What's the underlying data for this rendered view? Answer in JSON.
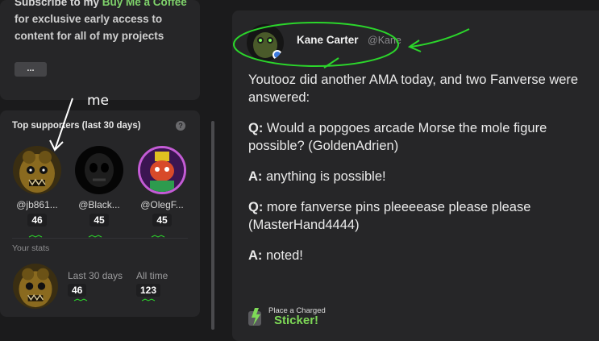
{
  "promo": {
    "line1": "Subscribe to my ",
    "link": "Buy Me a Coffee",
    "line2": " for exclusive early access to content for all of my projects",
    "more_label": "..."
  },
  "supporters": {
    "title": "Top supporters (last 30 days)",
    "help_icon": "?",
    "items": [
      {
        "name": "@jb861...",
        "count": "46",
        "avatar": "golden-animatronic-avatar"
      },
      {
        "name": "@Black...",
        "count": "45",
        "avatar": "dark-skull-avatar"
      },
      {
        "name": "@OlegF...",
        "count": "45",
        "avatar": "colorful-character-avatar"
      }
    ],
    "your_stats_label": "Your stats",
    "stats": [
      {
        "label": "Last 30 days",
        "value": "46"
      },
      {
        "label": "All time",
        "value": "123"
      }
    ]
  },
  "post": {
    "author": "Kane Carter",
    "handle": "@Kane",
    "intro": "Youtooz did another AMA today, and two Fanverse were answered:",
    "qa": [
      {
        "prefix": "Q:",
        "text": " Would a popgoes arcade Morse the mole figure possible? (GoldenAdrien)"
      },
      {
        "prefix": "A:",
        "text": " anything is possible!"
      },
      {
        "prefix": "Q:",
        "text": " more fanverse pins pleeeease please please (MasterHand4444)"
      },
      {
        "prefix": "A:",
        "text": " noted!"
      }
    ],
    "sticker": {
      "small": "Place a Charged",
      "big": "Sticker!"
    }
  },
  "annotations": {
    "me_label": "me",
    "color": "#2bd62b"
  },
  "colors": {
    "accent_green": "#7fd36b",
    "card_bg": "#262628",
    "page_bg": "#1b1b1c"
  }
}
